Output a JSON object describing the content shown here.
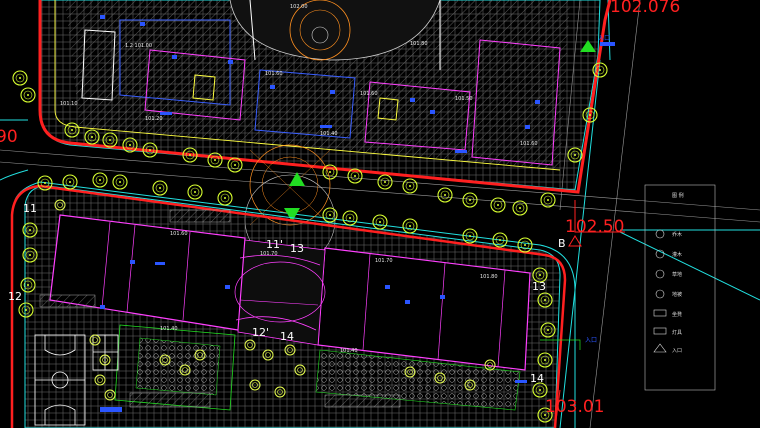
{
  "drawing": {
    "elevations": {
      "top_right": "102.076",
      "right": "102.50",
      "bottom_right": "103.01",
      "left_edge": "90"
    },
    "section_marker": "B",
    "axis_labels": [
      "11",
      "12",
      "13",
      "14",
      "11'",
      "13",
      "12'",
      "14"
    ],
    "blue_tags": [
      "入口",
      "入口"
    ],
    "legend_title": "图 例",
    "legend_items": [
      {
        "icon": "circle-icon",
        "text": "乔木"
      },
      {
        "icon": "tree-icon",
        "text": "灌木"
      },
      {
        "icon": "shrub-icon",
        "text": "草地"
      },
      {
        "icon": "dot-icon",
        "text": "地被"
      },
      {
        "icon": "bench-icon",
        "text": "坐凳"
      },
      {
        "icon": "lamp-icon",
        "text": "灯具"
      },
      {
        "icon": "arrow-icon",
        "text": "入口"
      }
    ]
  },
  "colors": {
    "background": "#000000",
    "site_boundary": "#ff2020",
    "road_edge": "#22e0e0",
    "building": "#ff40ff",
    "tree": "#d8ff30",
    "paving": "#8a8a8a",
    "label_blue": "#2a55ff",
    "accent_green": "#22dd22"
  }
}
